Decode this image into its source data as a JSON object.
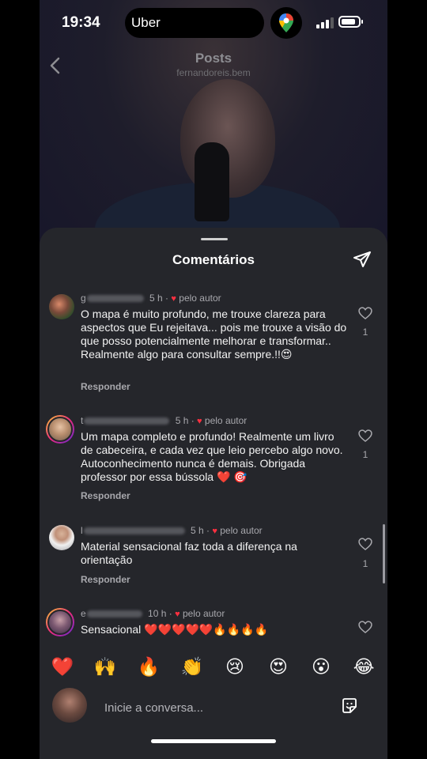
{
  "status_bar": {
    "time": "19:34",
    "dynamic_island_app": "Uber",
    "icons": [
      "location-arrow-icon",
      "google-maps-icon",
      "signal-icon",
      "battery-icon"
    ]
  },
  "nav": {
    "title": "Posts",
    "subtitle": "fernandoreis.bem",
    "back_icon": "chevron-left-icon"
  },
  "sheet": {
    "title": "Comentários",
    "share_icon": "send-icon"
  },
  "comments": [
    {
      "username_visible": "g",
      "time": "5 h",
      "author_like": "pelo autor",
      "text": "O mapa é muito profundo, me trouxe clareza para aspectos que Eu rejeitava... pois me trouxe a visão  do que posso potencialmente melhorar e transformar.. Realmente algo para consultar sempre.!!😍",
      "reply": "Responder",
      "likes": "1"
    },
    {
      "username_visible": "t",
      "time": "5 h",
      "author_like": "pelo autor",
      "text": "Um mapa completo e profundo! Realmente um livro de cabeceira, e cada vez que leio percebo algo novo. Autoconhecimento nunca é demais. Obrigada professor por essa bússola ❤️ 🎯",
      "reply": "Responder",
      "likes": "1"
    },
    {
      "username_visible": "l",
      "time": "5 h",
      "author_like": "pelo autor",
      "text": "Material sensacional faz toda a diferença na orientação",
      "reply": "Responder",
      "likes": "1"
    },
    {
      "username_visible": "e",
      "time": "10 h",
      "author_like": "pelo autor",
      "text": "Sensacional ❤️❤️❤️❤️❤️🔥🔥🔥🔥",
      "reply": "",
      "likes": ""
    }
  ],
  "quick_reactions": [
    "❤️",
    "🙌",
    "🔥",
    "👏",
    "😢",
    "😍",
    "😮",
    "😂"
  ],
  "composer": {
    "placeholder": "Inicie a conversa...",
    "sticker_icon": "sticker-icon"
  },
  "colors": {
    "sheet_bg": "#25262b",
    "heart_red": "#ff3040",
    "muted_text": "#a8a8ad"
  }
}
